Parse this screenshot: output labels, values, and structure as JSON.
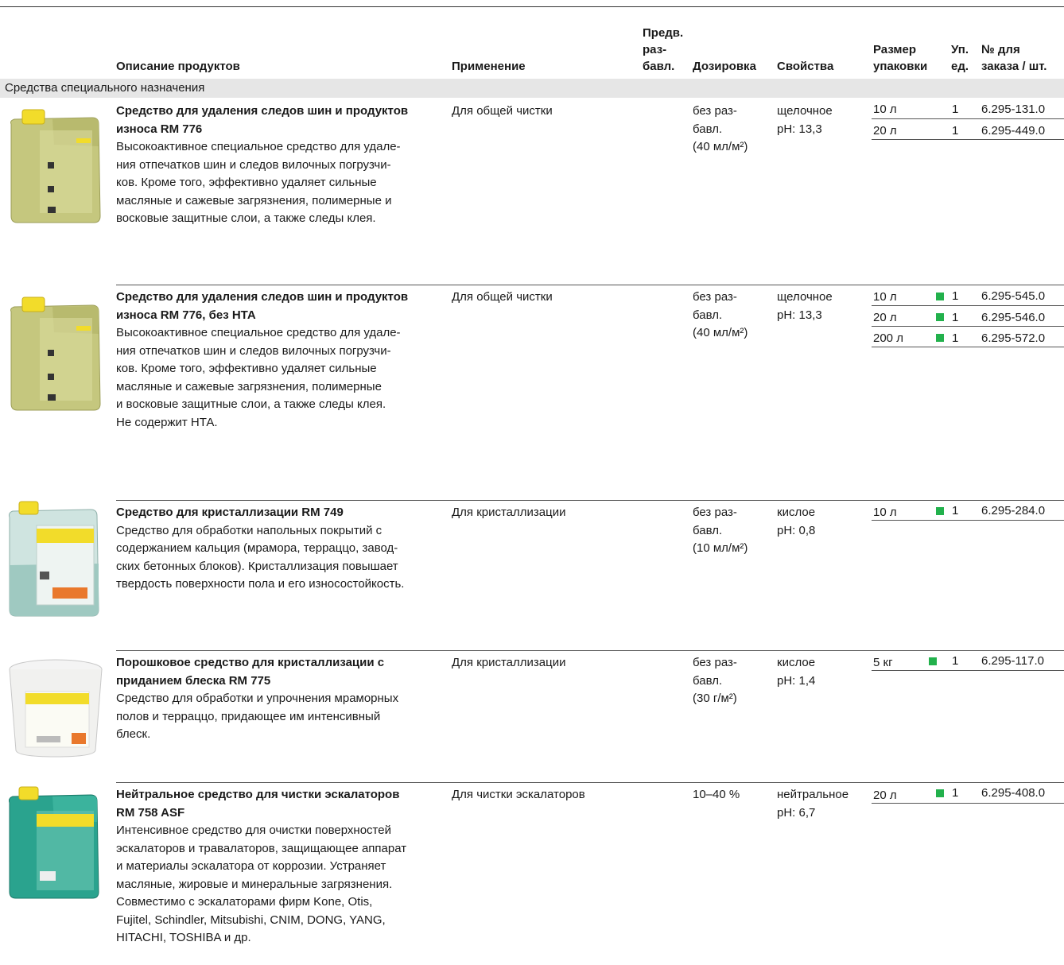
{
  "header": {
    "description": "Описание продуктов",
    "application": "Применение",
    "predilution_l1": "Предв.",
    "predilution_l2": "раз-",
    "predilution_l3": "бавл.",
    "dosage": "Дозировка",
    "properties": "Свойства",
    "pack_l1": "Размер",
    "pack_l2": "упаковки",
    "unit_l1": "Уп.",
    "unit_l2": "ед.",
    "order_l1": "№ для",
    "order_l2": "заказа / шт."
  },
  "section": {
    "title": "Средства специального назначения"
  },
  "colors": {
    "accent_square": "#22b14c",
    "section_bg": "#e6e6e6"
  },
  "products": [
    {
      "title_l1": "Средство для удаления следов шин и продуктов",
      "title_l2": "износа RM 776",
      "text_lines": [
        "Высокоактивное специальное средство для удале-",
        "ния отпечатков шин и следов вилочных погрузчи-",
        "ков. Кроме того, эффективно удаляет сильные",
        "масляные и сажевые загрязнения, полимерные и",
        "восковые защитные слои, а также следы клея."
      ],
      "application": "Для общей чистки",
      "dose_l1": "без раз-",
      "dose_l2": "бавл.",
      "dose_l3": "(40 мл/м²)",
      "props_l1": "щелочное",
      "props_l2": "pH: 13,3",
      "packs": [
        {
          "size": "10 л",
          "unit": "1",
          "order": "6.295-131.0",
          "marked": false
        },
        {
          "size": "20 л",
          "unit": "1",
          "order": "6.295-449.0",
          "marked": false
        }
      ]
    },
    {
      "title_l1": "Средство для удаления следов шин и продуктов",
      "title_l2": "износа RM 776, без НТА",
      "text_lines": [
        "Высокоактивное специальное средство для удале-",
        "ния отпечатков шин и следов вилочных погрузчи-",
        "ков. Кроме того, эффективно удаляет сильные",
        "масляные и сажевые загрязнения, полимерные",
        "и восковые защитные слои, а также следы клея.",
        "Не содержит НТА."
      ],
      "application": "Для общей чистки",
      "dose_l1": "без раз-",
      "dose_l2": "бавл.",
      "dose_l3": "(40 мл/м²)",
      "props_l1": "щелочное",
      "props_l2": "pH: 13,3",
      "packs": [
        {
          "size": "10 л",
          "unit": "1",
          "order": "6.295-545.0",
          "marked": true
        },
        {
          "size": "20 л",
          "unit": "1",
          "order": "6.295-546.0",
          "marked": true
        },
        {
          "size": "200 л",
          "unit": "1",
          "order": "6.295-572.0",
          "marked": true
        }
      ]
    },
    {
      "title_l1": "Средство для кристаллизации RM 749",
      "title_l2": "",
      "text_lines": [
        "Средство для обработки напольных покрытий с",
        "содержанием кальция (мрамора, терраццо, завод-",
        "ских бетонных блоков). Кристаллизация повышает",
        "твердость поверхности пола и его износостойкость."
      ],
      "application": "Для кристаллизации",
      "dose_l1": "без раз-",
      "dose_l2": "бавл.",
      "dose_l3": "(10 мл/м²)",
      "props_l1": "кислое",
      "props_l2": "pH: 0,8",
      "packs": [
        {
          "size": "10 л",
          "unit": "1",
          "order": "6.295-284.0",
          "marked": true
        }
      ]
    },
    {
      "title_l1": "Порошковое средство для кристаллизации с",
      "title_l2": "приданием блеска RM 775",
      "text_lines": [
        "Средство для обработки и упрочнения мраморных",
        "полов и терраццо, придающее им интенсивный",
        "блеск."
      ],
      "application": "Для кристаллизации",
      "dose_l1": "без раз-",
      "dose_l2": "бавл.",
      "dose_l3": "(30 г/м²)",
      "props_l1": "кислое",
      "props_l2": "pH: 1,4",
      "packs": [
        {
          "size": "5 кг",
          "unit": "1",
          "order": "6.295-117.0",
          "marked": true
        }
      ]
    },
    {
      "title_l1": "Нейтральное средство для чистки эскалаторов",
      "title_l2": "RM 758 ASF",
      "text_lines": [
        "Интенсивное средство для очистки поверхностей",
        "эскалаторов и травалаторов, защищающее аппарат",
        "и материалы эскалатора от коррозии. Устраняет",
        "масляные, жировые и минеральные загрязнения.",
        "Совместимо с эскалаторами фирм Kone, Otis,",
        "Fujitel, Schindler, Mitsubishi, CNIM, DONG, YANG,",
        "HITACHI, TOSHIBA и др."
      ],
      "application": "Для чистки эскалаторов",
      "dose_l1": "10–40 %",
      "dose_l2": "",
      "dose_l3": "",
      "props_l1": "нейтральное",
      "props_l2": "pH: 6,7",
      "packs": [
        {
          "size": "20 л",
          "unit": "1",
          "order": "6.295-408.0",
          "marked": true
        }
      ]
    }
  ]
}
